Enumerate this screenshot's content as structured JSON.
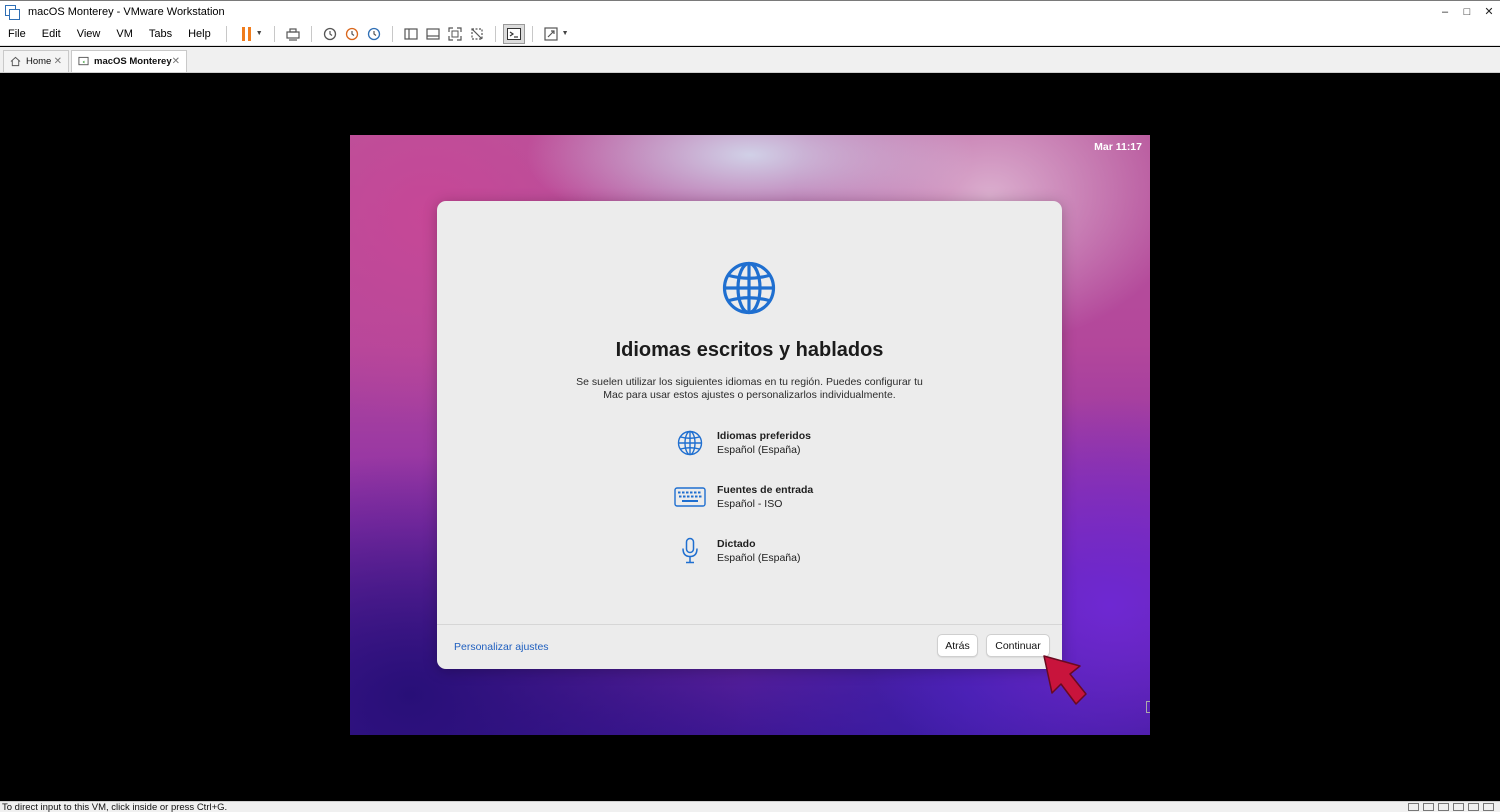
{
  "window": {
    "title": "macOS Monterey - VMware Workstation",
    "controls": {
      "minimize": "–",
      "maximize": "□",
      "close": "✕"
    }
  },
  "menubar": {
    "items": [
      "File",
      "Edit",
      "View",
      "VM",
      "Tabs",
      "Help"
    ]
  },
  "toolbar": {
    "icons": [
      "pause-icon",
      "send-ctrl-alt-del-icon",
      "snapshot-icon",
      "revert-snapshot-icon",
      "snapshot-manager-icon",
      "show-library-icon",
      "thumbnail-bar-icon",
      "full-screen-icon",
      "unity-icon",
      "console-view-icon",
      "stretch-guest-icon"
    ],
    "accent": "#f07c1c"
  },
  "tabs": [
    {
      "label": "Home",
      "close": "✕"
    },
    {
      "label": "macOS Monterey",
      "close": "✕"
    }
  ],
  "guest": {
    "clock": "Mar 11:17",
    "dialog": {
      "title": "Idiomas escritos y hablados",
      "description": "Se suelen utilizar los siguientes idiomas en tu región. Puedes configurar tu Mac para usar estos ajustes o personalizarlos individualmente.",
      "settings": [
        {
          "icon": "globe-icon",
          "title": "Idiomas preferidos",
          "value": "Español (España)"
        },
        {
          "icon": "keyboard-icon",
          "title": "Fuentes de entrada",
          "value": "Español - ISO"
        },
        {
          "icon": "microphone-icon",
          "title": "Dictado",
          "value": "Español (España)"
        }
      ],
      "customize_link": "Personalizar ajustes",
      "back_button": "Atrás",
      "continue_button": "Continuar",
      "accent": "#1f6fd0"
    }
  },
  "statusbar": {
    "message": "To direct input to this VM, click inside or press Ctrl+G."
  }
}
